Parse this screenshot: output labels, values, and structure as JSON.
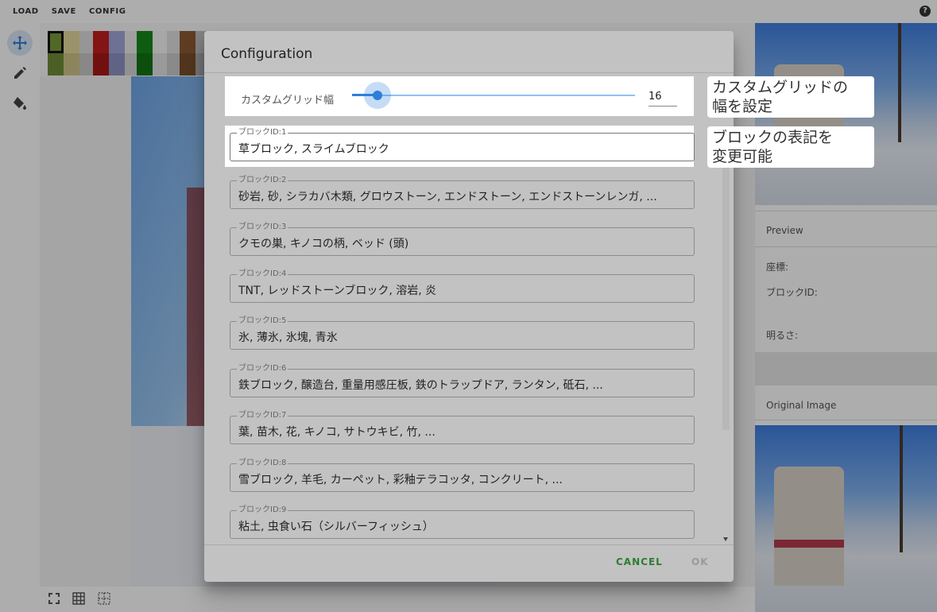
{
  "toolbar": {
    "menus": [
      "LOAD",
      "SAVE",
      "CONFIG"
    ],
    "help_icon": "help-circle-icon",
    "help_glyph": "?"
  },
  "tools": [
    "move-icon",
    "pencil-icon",
    "fill-bucket-icon"
  ],
  "palette_colors": [
    "#7a9a3a",
    "#e3d89c",
    "#dedede",
    "#c31f1f",
    "#a3a7d9",
    "#ffffff",
    "#158a18",
    "#f0f0f0",
    "#e0e0e0",
    "#8c5a34",
    "#bfbfbf"
  ],
  "right_panel": {
    "preview_title": "Preview",
    "coords_label": "座標:",
    "block_id_label": "ブロックID:",
    "brightness_label": "明るさ:",
    "original_title": "Original Image"
  },
  "dialog": {
    "title": "Configuration",
    "grid_label": "カスタムグリッド幅",
    "grid_value": "16",
    "blocks": [
      {
        "label": "ブロックID:1",
        "value": "草ブロック, スライムブロック"
      },
      {
        "label": "ブロックID:2",
        "value": "砂岩, 砂, シラカバ木類, グロウストーン, エンドストーン, エンドストーンレンガ, ..."
      },
      {
        "label": "ブロックID:3",
        "value": "クモの巣, キノコの柄, ベッド (頭)"
      },
      {
        "label": "ブロックID:4",
        "value": "TNT, レッドストーンブロック, 溶岩, 炎"
      },
      {
        "label": "ブロックID:5",
        "value": "氷, 薄氷, 氷塊, 青氷"
      },
      {
        "label": "ブロックID:6",
        "value": "鉄ブロック, 醸造台, 重量用感圧板, 鉄のトラップドア, ランタン, 砥石, ..."
      },
      {
        "label": "ブロックID:7",
        "value": "葉, 苗木, 花, キノコ, サトウキビ, 竹, ..."
      },
      {
        "label": "ブロックID:8",
        "value": "雪ブロック, 羊毛, カーペット, 彩釉テラコッタ, コンクリート, ..."
      },
      {
        "label": "ブロックID:9",
        "value": "粘土, 虫食い石（シルバーフィッシュ）"
      }
    ],
    "cancel_label": "CANCEL",
    "ok_label": "OK"
  },
  "callouts": {
    "grid_line1": "カスタムグリッドの",
    "grid_line2": "幅を設定",
    "block_line1": "ブロックの表記を",
    "block_line2": "変更可能"
  }
}
